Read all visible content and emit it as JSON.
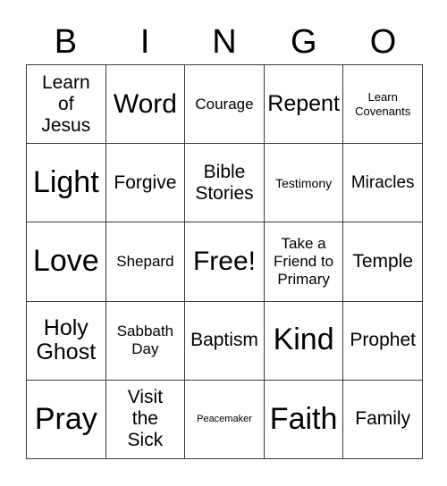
{
  "card": {
    "header_letters": [
      "B",
      "I",
      "N",
      "G",
      "O"
    ],
    "colors": {
      "background": "#ffffff",
      "text": "#000000",
      "grid_line": "#3a3a3a"
    },
    "rows": [
      [
        {
          "label": "Learn\nof\nJesus",
          "size": "md"
        },
        {
          "label": "Word",
          "size": "xl"
        },
        {
          "label": "Courage",
          "size": "xs"
        },
        {
          "label": "Repent",
          "size": "lg"
        },
        {
          "label": "Learn\nCovenants",
          "size": "3xs"
        }
      ],
      [
        {
          "label": "Light",
          "size": "xxl"
        },
        {
          "label": "Forgive",
          "size": "md"
        },
        {
          "label": "Bible\nStories",
          "size": "md"
        },
        {
          "label": "Testimony",
          "size": "xxs"
        },
        {
          "label": "Miracles",
          "size": "sm"
        }
      ],
      [
        {
          "label": "Love",
          "size": "xxl"
        },
        {
          "label": "Shepard",
          "size": "xs"
        },
        {
          "label": "Free!",
          "size": "xl"
        },
        {
          "label": "Take a\nFriend to\nPrimary",
          "size": "xs"
        },
        {
          "label": "Temple",
          "size": "md"
        }
      ],
      [
        {
          "label": "Holy\nGhost",
          "size": "lg"
        },
        {
          "label": "Sabbath\nDay",
          "size": "xs"
        },
        {
          "label": "Baptism",
          "size": "md"
        },
        {
          "label": "Kind",
          "size": "xxl"
        },
        {
          "label": "Prophet",
          "size": "md"
        }
      ],
      [
        {
          "label": "Pray",
          "size": "xxl"
        },
        {
          "label": "Visit\nthe\nSick",
          "size": "md"
        },
        {
          "label": "Peacemaker",
          "size": "4xs"
        },
        {
          "label": "Faith",
          "size": "xxl"
        },
        {
          "label": "Family",
          "size": "md"
        }
      ]
    ]
  }
}
